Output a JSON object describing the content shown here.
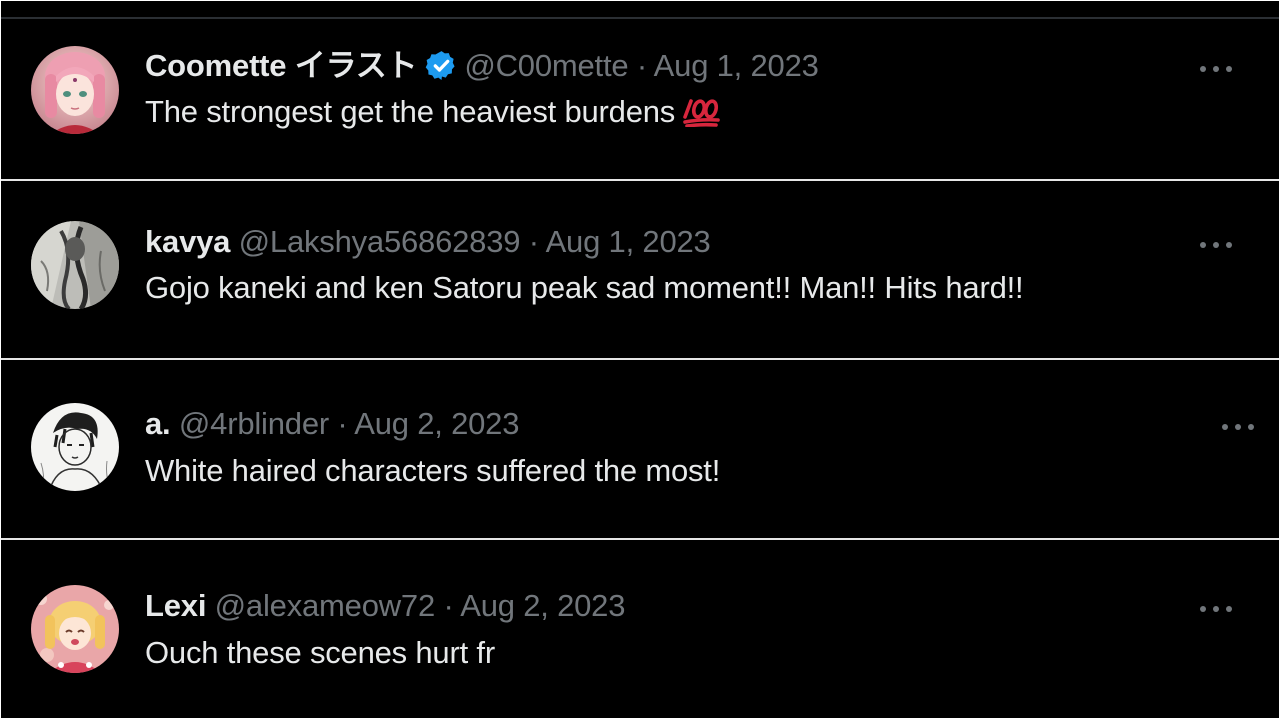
{
  "feed": {
    "tweets": [
      {
        "name": "Coomette イラスト",
        "verified": true,
        "handle": "@C00mette",
        "separator": "·",
        "date": "Aug 1, 2023",
        "text": "The strongest get the heaviest burdens",
        "emoji": "hundred-points-icon",
        "avatar": "pink-haired-anime-avatar"
      },
      {
        "name": "kavya",
        "verified": false,
        "handle": "@Lakshya56862839",
        "separator": "·",
        "date": "Aug 1, 2023",
        "text": "Gojo kaneki and ken Satoru peak sad moment!! Man!! Hits hard!!",
        "avatar": "grayscale-sketch-avatar"
      },
      {
        "name": "a.",
        "verified": false,
        "handle": "@4rblinder",
        "separator": "·",
        "date": "Aug 2, 2023",
        "text": "White haired characters suffered the most!",
        "avatar": "ink-manga-avatar"
      },
      {
        "name": "Lexi",
        "verified": false,
        "handle": "@alexameow72",
        "separator": "·",
        "date": "Aug 2, 2023",
        "text": "Ouch these scenes hurt fr",
        "avatar": "blonde-anime-avatar"
      }
    ]
  },
  "colors": {
    "background": "#000000",
    "name": "#e7e9ea",
    "secondary": "#71767b",
    "verified": "#1d9bf0",
    "divider": "#e6e6e6"
  },
  "icons": {
    "more": "more-options-icon",
    "verified": "verified-badge-icon"
  }
}
